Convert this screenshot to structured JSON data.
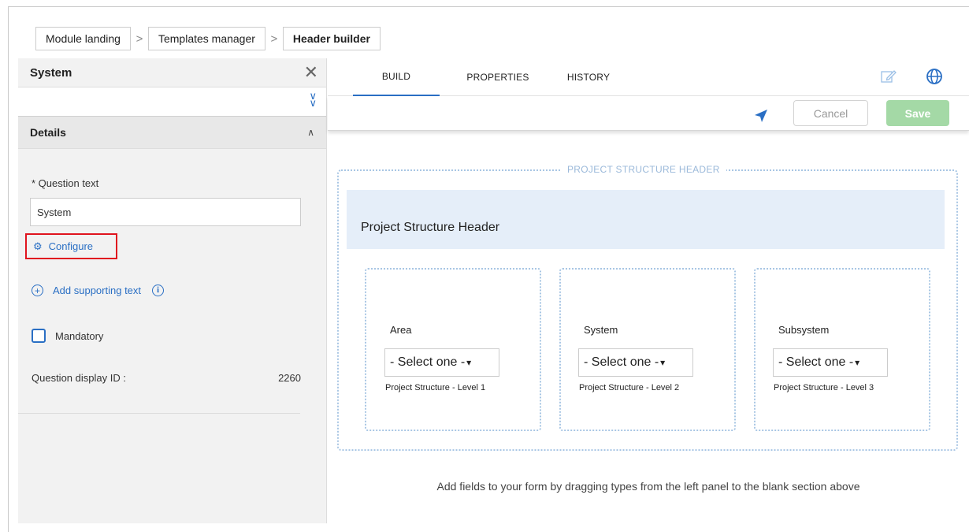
{
  "breadcrumb": [
    "Module landing",
    "Templates manager",
    "Header builder"
  ],
  "left_panel": {
    "title": "System",
    "details_title": "Details",
    "question_label": "* Question text",
    "question_value": "System",
    "configure_label": "Configure",
    "add_supporting_label": "Add supporting text",
    "mandatory_label": "Mandatory",
    "display_id_label": "Question display ID :",
    "display_id_value": "2260"
  },
  "tabs": [
    {
      "label": "BUILD",
      "active": true
    },
    {
      "label": "PROPERTIES",
      "active": false
    },
    {
      "label": "HISTORY",
      "active": false
    }
  ],
  "actions": {
    "cancel": "Cancel",
    "save": "Save"
  },
  "section": {
    "legend": "PROJECT STRUCTURE HEADER",
    "title": "Project Structure Header",
    "fields": [
      {
        "label": "Area",
        "select": "- Select one -",
        "caption": "Project Structure - Level 1"
      },
      {
        "label": "System",
        "select": "- Select one -",
        "caption": "Project Structure - Level 2"
      },
      {
        "label": "Subsystem",
        "select": "- Select one -",
        "caption": "Project Structure - Level 3"
      }
    ]
  },
  "footer_note": "Add fields to your form by dragging types from the left panel to the blank section above",
  "colors": {
    "accent": "#2a6fc4",
    "save": "#a4d9a6",
    "highlight": "#e0141e",
    "band": "#e5eef9"
  }
}
